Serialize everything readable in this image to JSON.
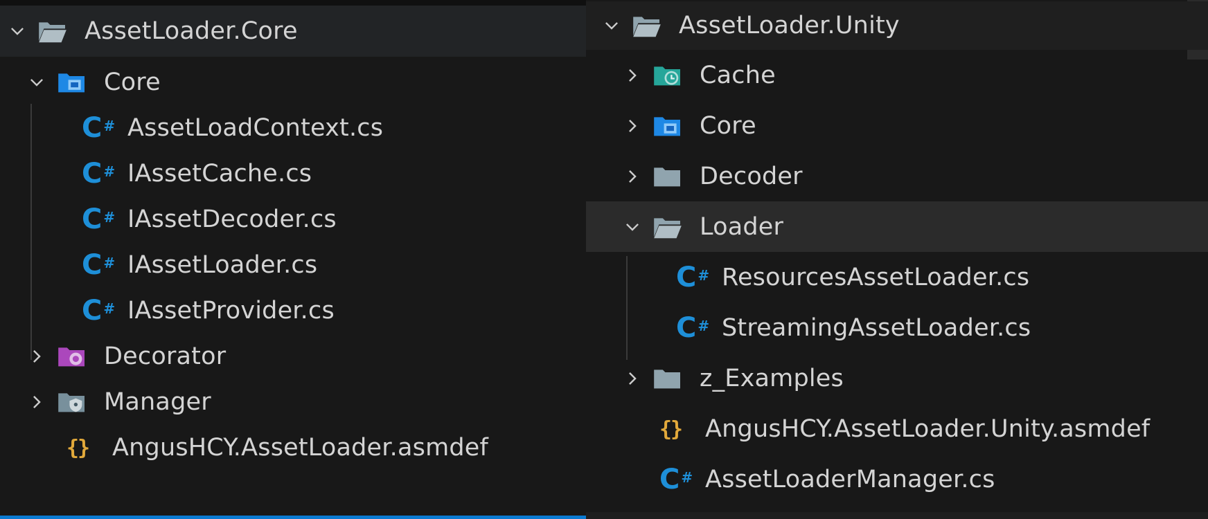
{
  "left_panel": {
    "root": {
      "label": "AssetLoader.Core",
      "icon": "folder-open-icon",
      "expanded": true
    },
    "items": [
      {
        "label": "Core",
        "icon": "folder-core-icon",
        "expanded": true
      },
      {
        "label": "AssetLoadContext.cs",
        "icon": "csharp-icon"
      },
      {
        "label": "IAssetCache.cs",
        "icon": "csharp-icon"
      },
      {
        "label": "IAssetDecoder.cs",
        "icon": "csharp-icon"
      },
      {
        "label": "IAssetLoader.cs",
        "icon": "csharp-icon"
      },
      {
        "label": "IAssetProvider.cs",
        "icon": "csharp-icon"
      },
      {
        "label": "Decorator",
        "icon": "folder-decorator-icon",
        "expanded": false
      },
      {
        "label": "Manager",
        "icon": "folder-manager-icon",
        "expanded": false
      },
      {
        "label": "AngusHCY.AssetLoader.asmdef",
        "icon": "json-braces-icon"
      }
    ]
  },
  "right_panel": {
    "root": {
      "label": "AssetLoader.Unity",
      "icon": "folder-open-icon",
      "expanded": true
    },
    "items": [
      {
        "label": "Cache",
        "icon": "folder-cache-icon",
        "expanded": false
      },
      {
        "label": "Core",
        "icon": "folder-core-icon",
        "expanded": false
      },
      {
        "label": "Decoder",
        "icon": "folder-icon",
        "expanded": false
      },
      {
        "label": "Loader",
        "icon": "folder-open-icon",
        "expanded": true,
        "selected": true
      },
      {
        "label": "ResourcesAssetLoader.cs",
        "icon": "csharp-icon"
      },
      {
        "label": "StreamingAssetLoader.cs",
        "icon": "csharp-icon"
      },
      {
        "label": "z_Examples",
        "icon": "folder-icon",
        "expanded": false
      },
      {
        "label": "AngusHCY.AssetLoader.Unity.asmdef",
        "icon": "json-braces-icon"
      },
      {
        "label": "AssetLoaderManager.cs",
        "icon": "csharp-icon"
      }
    ]
  },
  "colors": {
    "csharp": "#1e8fd8",
    "json": "#e2a93b",
    "folder": "#90a4ae",
    "folder_core": "#1e88e5",
    "folder_cache": "#26a69a",
    "folder_decorator": "#ab47bc",
    "accent_bar": "#0b7ad1"
  }
}
